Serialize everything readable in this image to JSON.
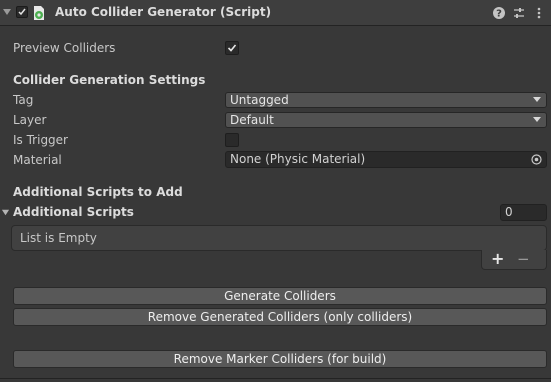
{
  "header": {
    "title": "Auto Collider Generator (Script)",
    "icons": [
      "foldout-arrow-icon",
      "component-enabled-checkbox",
      "script-icon",
      "help-icon",
      "presets-icon",
      "more-menu-icon"
    ]
  },
  "preview": {
    "label": "Preview Colliders",
    "checked": true
  },
  "collider_settings": {
    "heading": "Collider Generation Settings",
    "tag_label": "Tag",
    "tag_value": "Untagged",
    "layer_label": "Layer",
    "layer_value": "Default",
    "trigger_label": "Is Trigger",
    "trigger_checked": false,
    "material_label": "Material",
    "material_value": "None (Physic Material)"
  },
  "scripts": {
    "heading": "Additional Scripts to Add",
    "list_label": "Additional Scripts",
    "count": "0",
    "empty_text": "List is Empty",
    "add_label": "+",
    "remove_label": "−"
  },
  "buttons": {
    "generate": "Generate Colliders",
    "remove_generated": "Remove Generated Colliders (only colliders)",
    "remove_marker": "Remove Marker Colliders (for build)"
  },
  "colors": {
    "background": "#383838",
    "header": "#3e3e3e",
    "button": "#585858",
    "script_icon_green": "#4caf50"
  }
}
